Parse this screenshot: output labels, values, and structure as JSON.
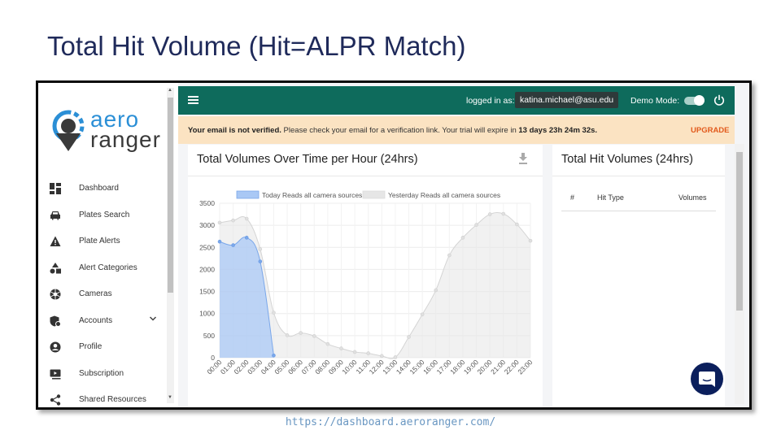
{
  "slide": {
    "title": "Total Hit Volume (Hit=ALPR Match)",
    "footer_url": "https://dashboard.aeroranger.com/"
  },
  "app": {
    "logo_line1": "aero",
    "logo_line2": "ranger",
    "logo_tm": "™",
    "brand_color": "#0e6b5c"
  },
  "sidebar": {
    "items": [
      {
        "label": "Dashboard",
        "icon": "dashboard-icon"
      },
      {
        "label": "Plates Search",
        "icon": "car-icon"
      },
      {
        "label": "Plate Alerts",
        "icon": "warning-icon"
      },
      {
        "label": "Alert Categories",
        "icon": "shapes-icon"
      },
      {
        "label": "Cameras",
        "icon": "aperture-icon"
      },
      {
        "label": "Accounts",
        "icon": "shield-user-icon",
        "has_submenu": true
      },
      {
        "label": "Profile",
        "icon": "user-circle-icon"
      },
      {
        "label": "Subscription",
        "icon": "subscription-icon"
      },
      {
        "label": "Shared Resources",
        "icon": "share-icon"
      }
    ]
  },
  "topbar": {
    "logged_in_label": "logged in as:",
    "user_email": "katina.michael@asu.edu",
    "demo_mode_label": "Demo Mode:",
    "demo_mode_on": true
  },
  "banner": {
    "bold_prefix": "Your email is not verified.",
    "message": " Please check your email for a verification link. Your trial will expire in ",
    "remaining": "13 days 23h 24m 32s.",
    "upgrade_label": "UPGRADE"
  },
  "volumes_card": {
    "title": "Total Volumes Over Time per Hour (24hrs)"
  },
  "hits_card": {
    "title": "Total Hit Volumes (24hrs)",
    "columns": [
      "#",
      "Hit Type",
      "Volumes"
    ]
  },
  "chart_data": {
    "type": "area",
    "x": [
      "00:00",
      "01:00",
      "02:00",
      "03:00",
      "04:00",
      "05:00",
      "06:00",
      "07:00",
      "08:00",
      "09:00",
      "10:00",
      "11:00",
      "12:00",
      "13:00",
      "14:00",
      "15:00",
      "16:00",
      "17:00",
      "18:00",
      "19:00",
      "20:00",
      "21:00",
      "22:00",
      "23:00"
    ],
    "ylim": [
      0,
      3500
    ],
    "yticks": [
      0,
      500,
      1000,
      1500,
      2000,
      2500,
      3000,
      3500
    ],
    "grid": true,
    "legend_position": "top",
    "series": [
      {
        "name": "Today Reads all camera sources",
        "color": "#a9c8f5",
        "values": [
          2630,
          2550,
          2720,
          2180,
          50
        ]
      },
      {
        "name": "Yesterday Reads all camera sources",
        "color": "#e6e6e6",
        "values": [
          3060,
          3110,
          3150,
          2460,
          1020,
          510,
          560,
          490,
          310,
          210,
          130,
          100,
          40,
          10,
          470,
          980,
          1530,
          2320,
          2720,
          3010,
          3250,
          3260,
          3020,
          2650
        ]
      }
    ]
  }
}
